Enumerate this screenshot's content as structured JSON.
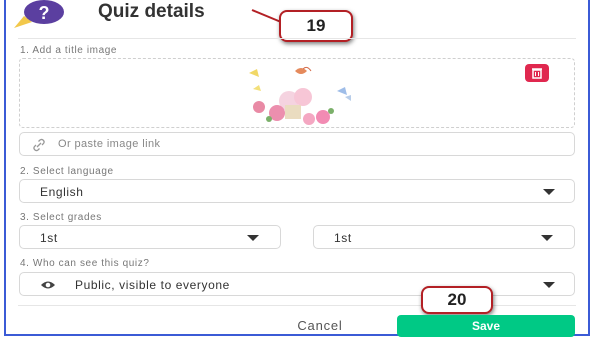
{
  "header": {
    "title": "Quiz details"
  },
  "annotations": {
    "step_a": "19",
    "step_b": "20"
  },
  "sections": {
    "title_image": "1. Add a title image",
    "language": "2. Select language",
    "grades": "3. Select grades",
    "visibility": "4. Who can see this quiz?"
  },
  "image_link": {
    "placeholder": "Or paste image link"
  },
  "language": {
    "selected": "English"
  },
  "grades": {
    "from": "1st",
    "to": "1st"
  },
  "visibility": {
    "selected": "Public, visible to everyone"
  },
  "footer": {
    "cancel_label": "Cancel",
    "save_label": "Save"
  },
  "colors": {
    "accent": "#00c985",
    "delete": "#e0284f",
    "callout_border": "#b32025",
    "frame": "#3b5bd6"
  }
}
